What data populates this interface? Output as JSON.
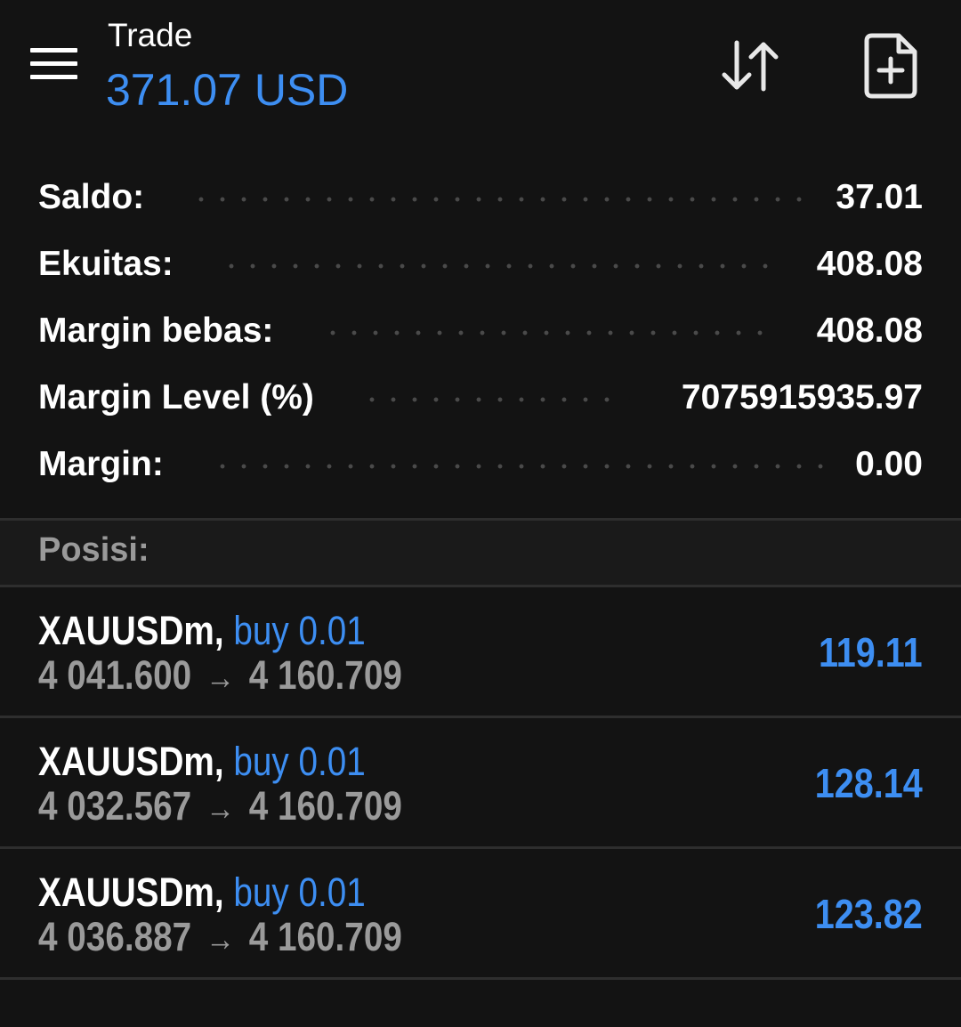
{
  "header": {
    "title": "Trade",
    "balance": "371.07 USD"
  },
  "summary": [
    {
      "label": "Saldo:",
      "value": "37.01"
    },
    {
      "label": "Ekuitas:",
      "value": "408.08"
    },
    {
      "label": "Margin bebas:",
      "value": "408.08"
    },
    {
      "label": "Margin Level (%)",
      "value": "7075915935.97"
    },
    {
      "label": "Margin:",
      "value": "0.00"
    }
  ],
  "positions_section": {
    "label": "Posisi:"
  },
  "positions": [
    {
      "symbol": "XAUUSDm,",
      "type": "buy 0.01",
      "open_price": "4 041.600",
      "arrow": "→",
      "current_price": "4 160.709",
      "profit": "119.11"
    },
    {
      "symbol": "XAUUSDm,",
      "type": "buy 0.01",
      "open_price": "4 032.567",
      "arrow": "→",
      "current_price": "4 160.709",
      "profit": "128.14"
    },
    {
      "symbol": "XAUUSDm,",
      "type": "buy 0.01",
      "open_price": "4 036.887",
      "arrow": "→",
      "current_price": "4 160.709",
      "profit": "123.82"
    }
  ],
  "colors": {
    "background": "#131313",
    "accent": "#3d8ef2",
    "secondary_text": "#9a9a9a"
  },
  "icons": {
    "menu": "hamburger-menu-icon",
    "sort": "sort-arrows-icon",
    "new_order": "document-plus-icon"
  }
}
